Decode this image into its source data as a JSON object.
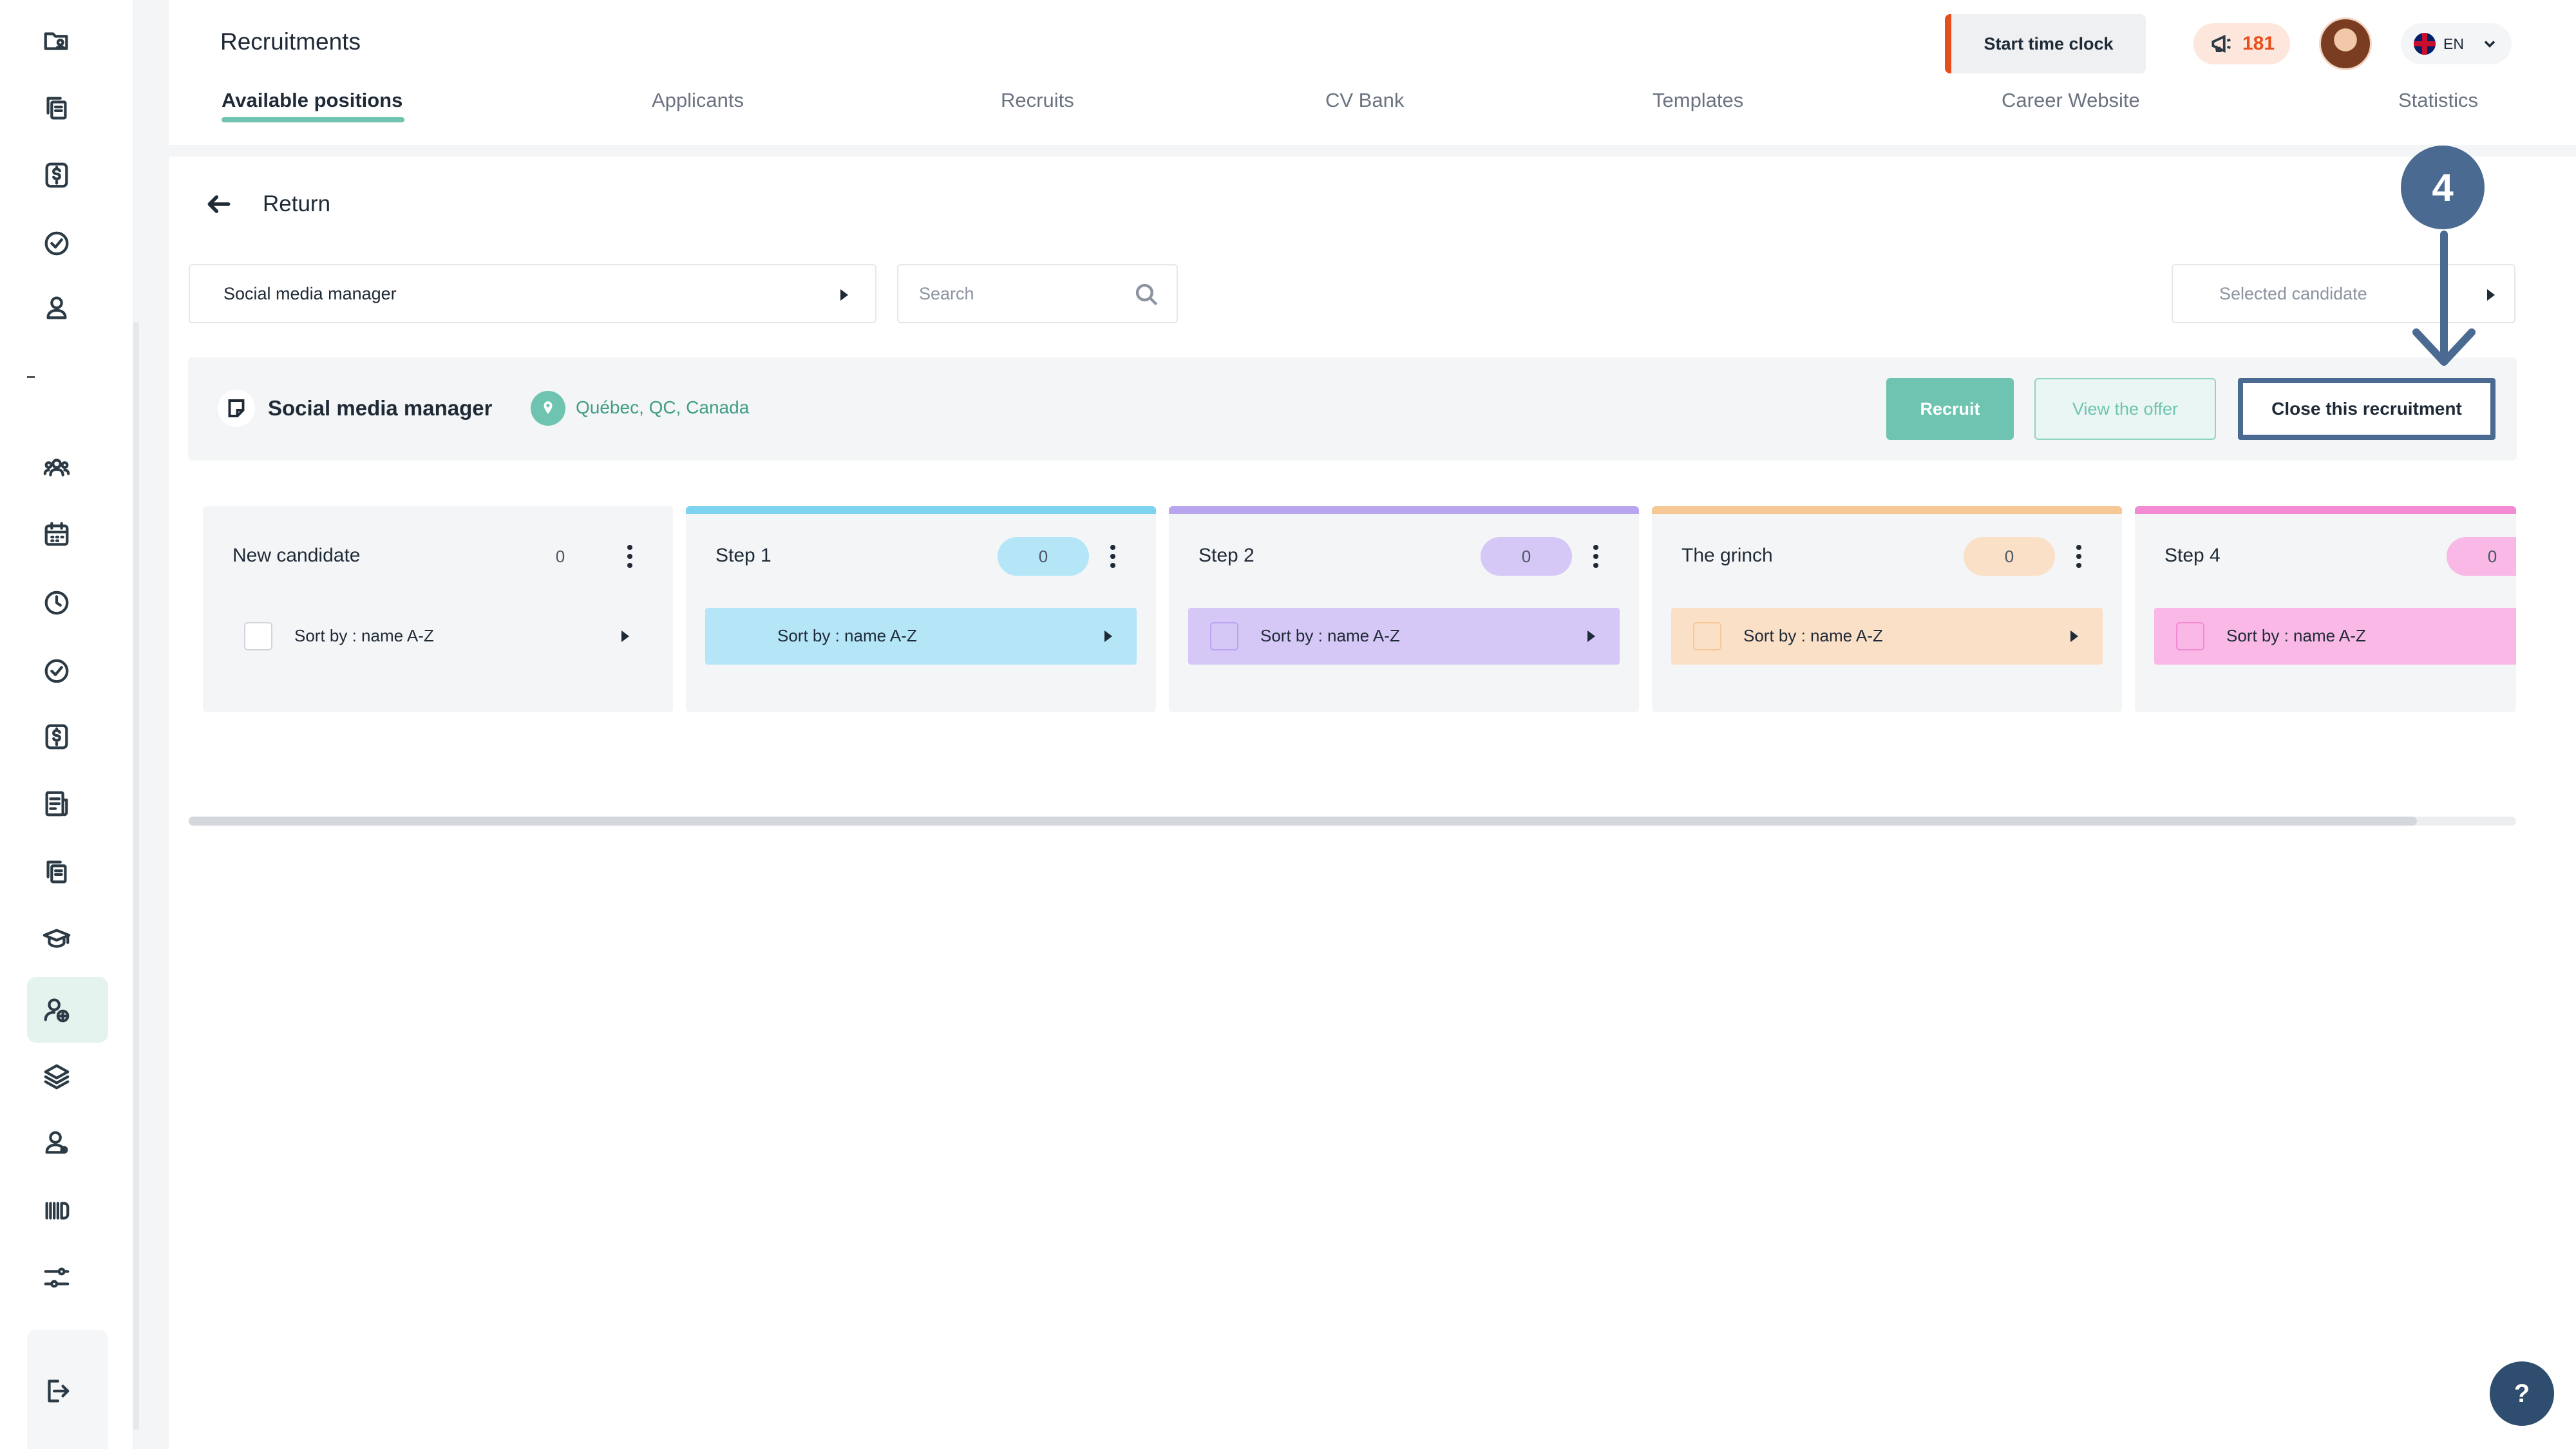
{
  "header": {
    "title": "Recruitments",
    "tabs": [
      {
        "label": "Available positions",
        "active": true
      },
      {
        "label": "Applicants"
      },
      {
        "label": "Recruits"
      },
      {
        "label": "CV Bank"
      },
      {
        "label": "Templates"
      },
      {
        "label": "Career Website"
      },
      {
        "label": "Statistics"
      }
    ],
    "clock_button": "Start time clock",
    "notifications": "181",
    "language": "EN"
  },
  "sidebar": {
    "icons": [
      "folder-user-icon",
      "documents-icon",
      "dollar-icon",
      "check-circle-icon",
      "user-icon",
      "users-group-icon",
      "calendar-icon",
      "clock-icon",
      "check-circle-icon",
      "dollar-icon",
      "report-icon",
      "documents-icon",
      "graduation-cap-icon",
      "user-plus-icon",
      "layers-icon",
      "user-settings-icon",
      "barcode-icon",
      "sliders-icon",
      "logout-icon"
    ],
    "active": "user-plus-icon"
  },
  "main": {
    "return_label": "Return",
    "position_select": "Social media manager",
    "search_placeholder": "Search",
    "candidate_select": "Selected candidate",
    "job": {
      "title": "Social media manager",
      "location": "Québec, QC, Canada",
      "recruit_label": "Recruit",
      "offer_label": "View the offer",
      "close_label": "Close this recruitment"
    },
    "columns": [
      {
        "name": "New candidate",
        "count": "0",
        "sort": "Sort by : name A-Z",
        "color": "#f4f5f6",
        "light": "#ffffff"
      },
      {
        "name": "Step 1",
        "count": "0",
        "sort": "Sort by : name A-Z",
        "color": "#7dd3f0",
        "light": "#b4e6f8"
      },
      {
        "name": "Step 2",
        "count": "0",
        "sort": "Sort by : name A-Z",
        "color": "#b9a4ef",
        "light": "#d5c8f6"
      },
      {
        "name": "The grinch",
        "count": "0",
        "sort": "Sort by : name A-Z",
        "color": "#f6c896",
        "light": "#fbe0c8"
      },
      {
        "name": "Step 4",
        "count": "0",
        "sort": "Sort by : name A-Z",
        "color": "#f38ad4",
        "light": "#f9b8e6"
      }
    ]
  },
  "annotation": {
    "step": "4",
    "color": "#4b6a92"
  },
  "help_label": "?"
}
